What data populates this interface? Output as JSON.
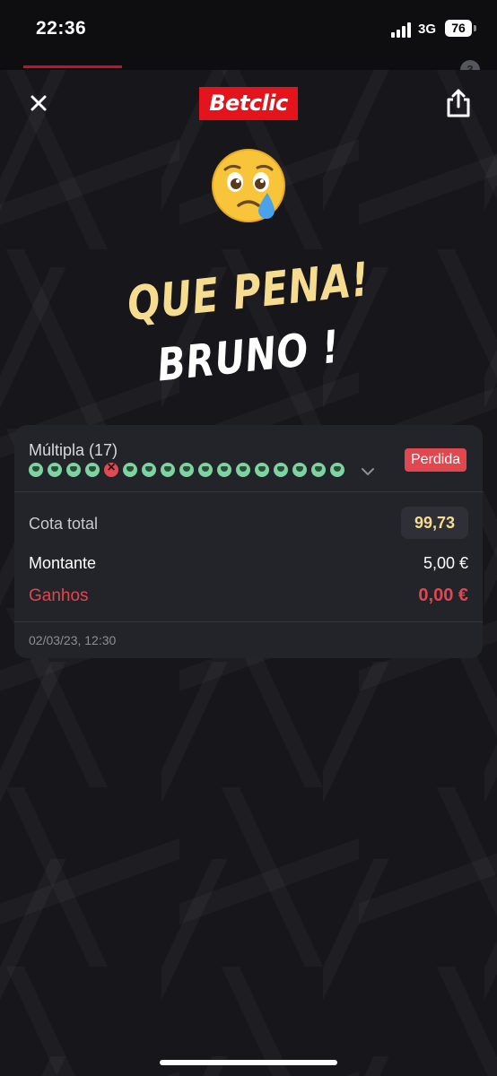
{
  "status_bar": {
    "time": "22:36",
    "network": "3G",
    "battery": "76"
  },
  "header": {
    "logo": "Betclic",
    "close_icon": "close-icon",
    "share_icon": "share-icon",
    "tab_badge": "3"
  },
  "emoji": "crying-face-emoji",
  "headline": {
    "line1": "QUE PENA!",
    "line2": "BRUNO !"
  },
  "bet": {
    "type_label": "Múltipla (17)",
    "status": "Perdida",
    "selections": [
      "won",
      "won",
      "won",
      "won",
      "lost",
      "won",
      "won",
      "won",
      "won",
      "won",
      "won",
      "won",
      "won",
      "won",
      "won",
      "won",
      "won"
    ],
    "odds_label": "Cota total",
    "odds_value": "99,73",
    "stake_label": "Montante",
    "stake_value": "5,00 €",
    "winnings_label": "Ganhos",
    "winnings_value": "0,00 €",
    "date": "02/03/23, 12:30"
  },
  "colors": {
    "brand": "#e3141c",
    "accent": "#f6dc8f",
    "lost": "#e0474f",
    "won": "#7ed3a0"
  }
}
